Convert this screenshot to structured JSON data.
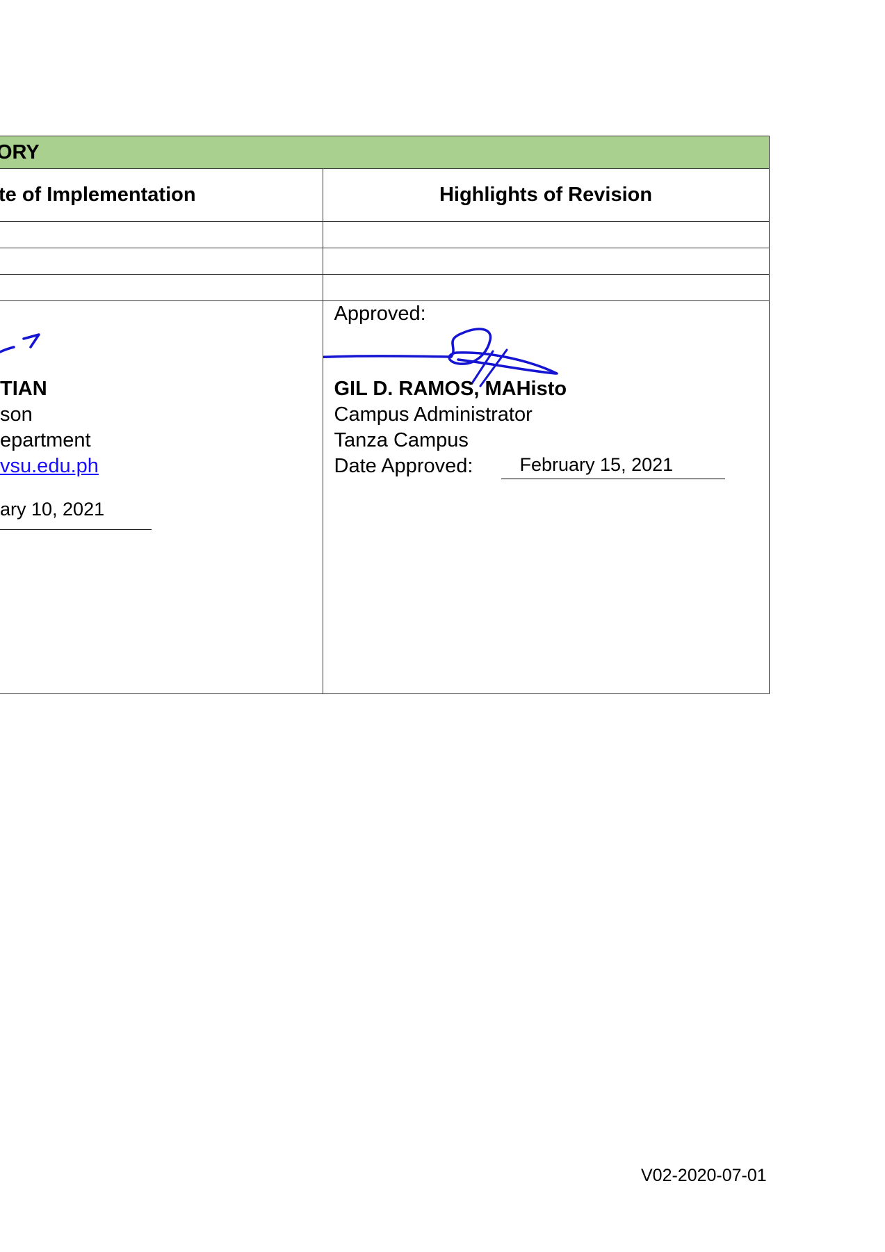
{
  "table": {
    "title": "ORY",
    "columns": {
      "left_header": "te of Implementation",
      "right_header": "Highlights of Revision"
    },
    "blank_rows": 3
  },
  "left_signatory": {
    "name": "TIAN",
    "position_line": "son",
    "department_line": "epartment",
    "email_link": "vsu.edu.ph",
    "date_value": "ary 10, 2021",
    "signature_color": "#1414d2"
  },
  "right_signatory": {
    "label": "Approved:",
    "name": "GIL D. RAMOS, MAHisto",
    "title": "Campus Administrator",
    "campus": "Tanza Campus",
    "date_label": "Date Approved:",
    "date_value": "February 15, 2021",
    "signature_color": "#1414d2"
  },
  "colors": {
    "header_fill": "#a9d08e",
    "link": "#1a0dff",
    "border": "#333333"
  },
  "footer": {
    "version_code": "V02-2020-07-01"
  }
}
